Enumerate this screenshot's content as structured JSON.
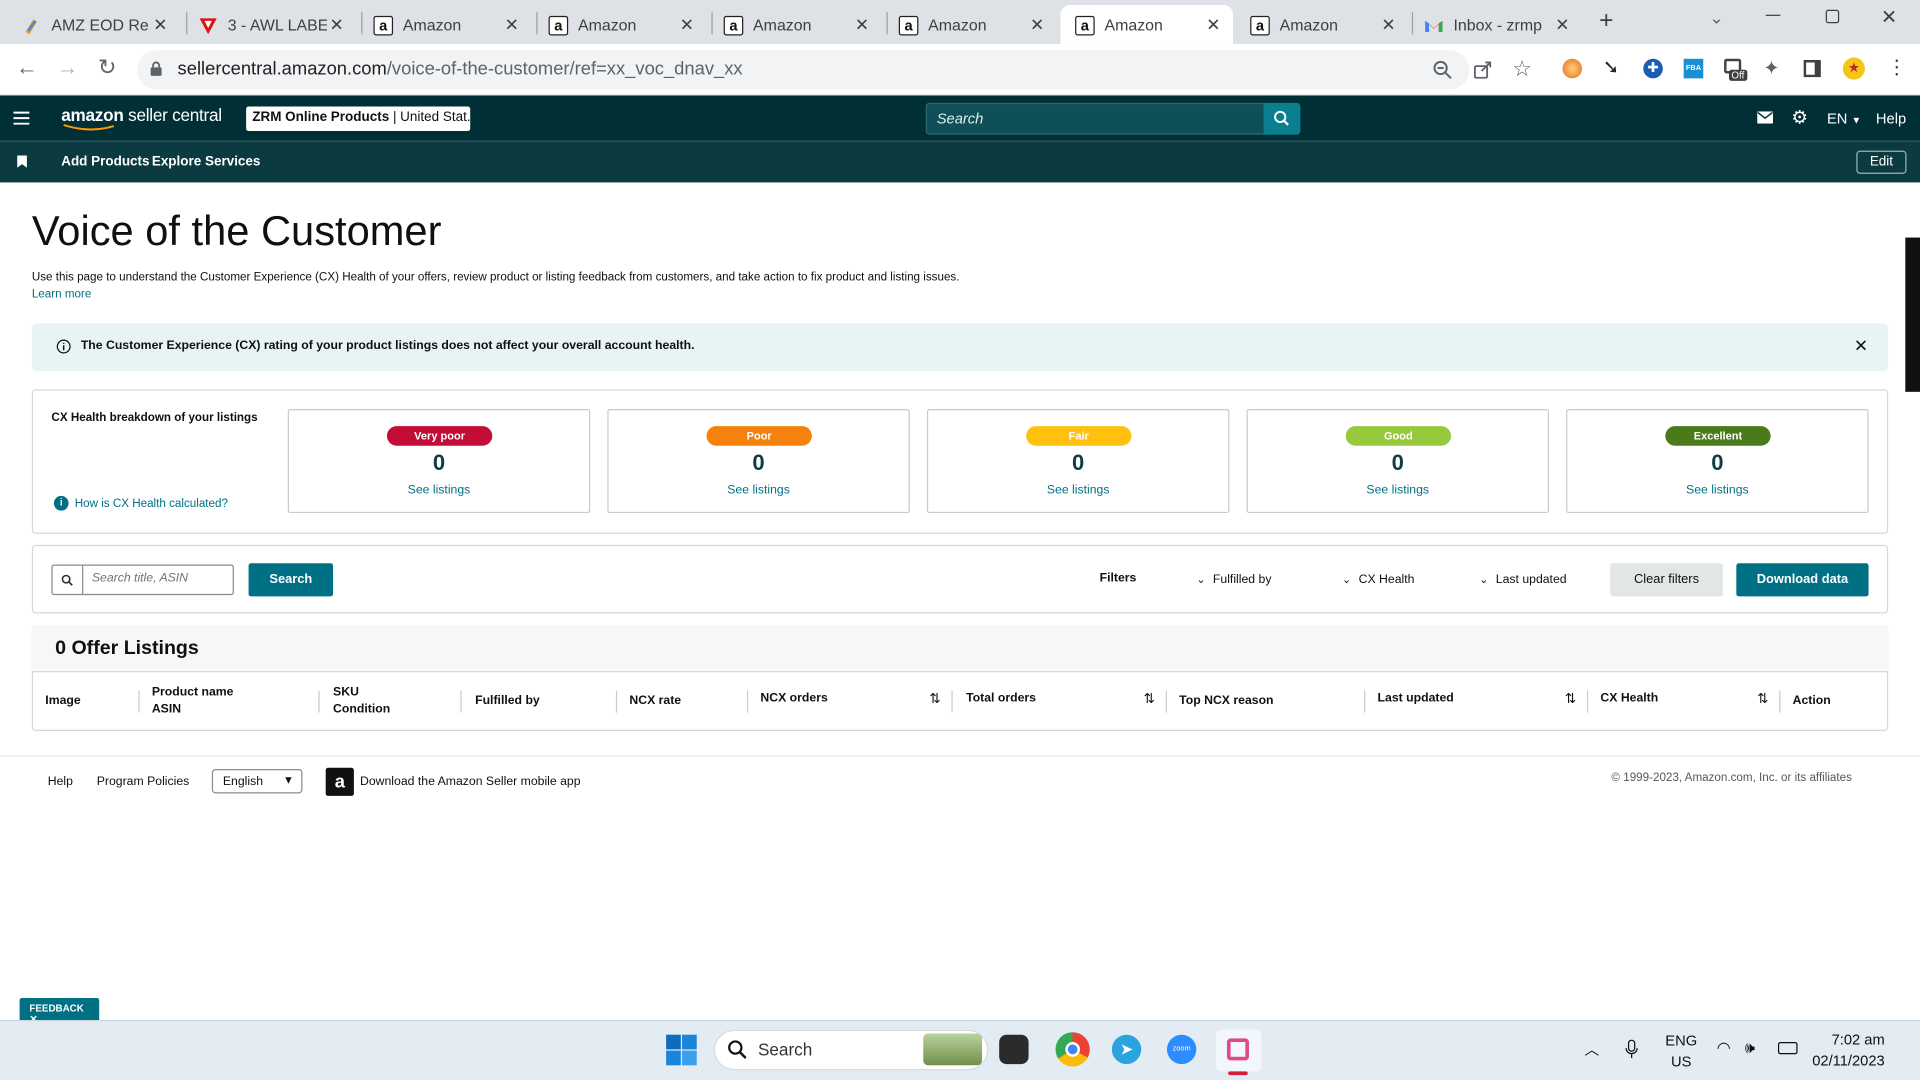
{
  "browser": {
    "tabs": [
      {
        "title": "AMZ EOD Re",
        "icon": "amz-eod-icon"
      },
      {
        "title": "3 - AWL LABE",
        "icon": "awl-label-icon"
      },
      {
        "title": "Amazon",
        "icon": "amazon-icon"
      },
      {
        "title": "Amazon",
        "icon": "amazon-icon"
      },
      {
        "title": "Amazon",
        "icon": "amazon-icon"
      },
      {
        "title": "Amazon",
        "icon": "amazon-icon"
      },
      {
        "title": "Amazon",
        "icon": "amazon-icon",
        "active": true
      },
      {
        "title": "Amazon",
        "icon": "amazon-icon"
      },
      {
        "title": "Inbox - zrmp",
        "icon": "gmail-icon"
      }
    ],
    "url_host": "sellercentral.amazon.com",
    "url_path": "/voice-of-the-customer/ref=xx_voc_dnav_xx",
    "ext_badge": "Off"
  },
  "header": {
    "logo_bold": "amazon",
    "logo_rest": " seller central",
    "store_bold": "ZRM Online Products",
    "store_rest": " | United Stat...",
    "search_placeholder": "Search",
    "lang": "EN",
    "help": "Help"
  },
  "subnav": {
    "items": [
      "Add Products",
      "Explore Services"
    ],
    "edit": "Edit"
  },
  "page": {
    "title": "Voice of the Customer",
    "description": "Use this page to understand the Customer Experience (CX) Health of your offers, review product or listing feedback from customers, and take action to fix product and listing issues.",
    "learn_more": "Learn more",
    "notice": "The Customer Experience (CX) rating of your product listings does not affect your overall account health."
  },
  "cx_health": {
    "title": "CX Health breakdown of your listings",
    "how_link": "How is CX Health calculated?",
    "tiles": [
      {
        "label": "Very poor",
        "count": "0",
        "link": "See listings",
        "color": "#c40c38"
      },
      {
        "label": "Poor",
        "count": "0",
        "link": "See listings",
        "color": "#f5820d"
      },
      {
        "label": "Fair",
        "count": "0",
        "link": "See listings",
        "color": "#ffc10e"
      },
      {
        "label": "Good",
        "count": "0",
        "link": "See listings",
        "color": "#97c93d"
      },
      {
        "label": "Excellent",
        "count": "0",
        "link": "See listings",
        "color": "#4a7a1a"
      }
    ]
  },
  "filters": {
    "search_placeholder": "Search title, ASIN",
    "search_button": "Search",
    "label": "Filters",
    "fulfilled_by": "Fulfilled by",
    "cx_health": "CX Health",
    "last_updated": "Last updated",
    "clear": "Clear filters",
    "download": "Download data"
  },
  "listings": {
    "title": "0 Offer Listings",
    "columns": [
      {
        "l1": "Image",
        "l2": ""
      },
      {
        "l1": "Product name",
        "l2": "ASIN"
      },
      {
        "l1": "SKU",
        "l2": "Condition"
      },
      {
        "l1": "Fulfilled by",
        "l2": ""
      },
      {
        "l1": "NCX rate",
        "l2": ""
      },
      {
        "l1": "NCX orders",
        "l2": ""
      },
      {
        "l1": "Total orders",
        "l2": ""
      },
      {
        "l1": "Top NCX reason",
        "l2": ""
      },
      {
        "l1": "Last updated",
        "l2": ""
      },
      {
        "l1": "CX Health",
        "l2": ""
      },
      {
        "l1": "Action",
        "l2": ""
      }
    ]
  },
  "footer": {
    "help": "Help",
    "policies": "Program Policies",
    "language": "English",
    "app": "Download the Amazon Seller mobile app",
    "copyright": "© 1999-2023, Amazon.com, Inc. or its affiliates"
  },
  "feedback": "FEEDBACK",
  "taskbar": {
    "search": "Search",
    "lang1": "ENG",
    "lang2": "US",
    "time": "7:02 am",
    "date": "02/11/2023"
  }
}
